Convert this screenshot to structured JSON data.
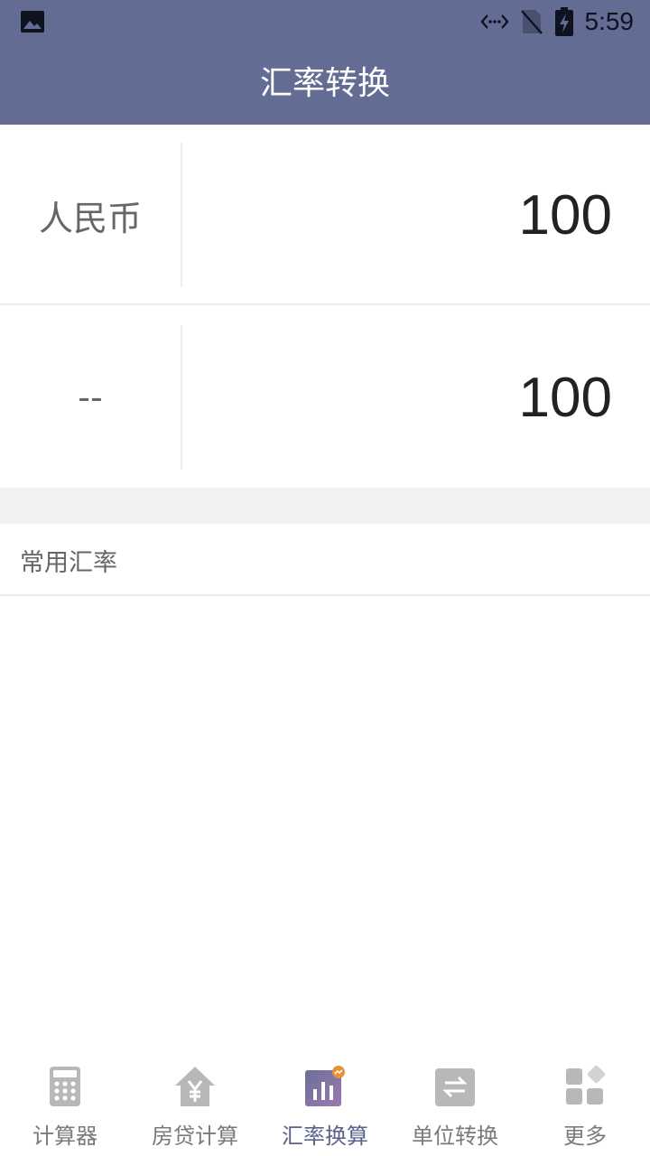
{
  "status_bar": {
    "time": "5:59",
    "icons": [
      "image-icon",
      "data-saver-icon",
      "no-sim-icon",
      "battery-charging-icon"
    ]
  },
  "header": {
    "title": "汇率转换"
  },
  "converter": {
    "from": {
      "currency": "人民币",
      "value": "100"
    },
    "to": {
      "currency": "--",
      "value": "100"
    }
  },
  "section": {
    "title": "常用汇率"
  },
  "tabs": [
    {
      "label": "计算器",
      "icon": "calculator-icon",
      "active": false
    },
    {
      "label": "房贷计算",
      "icon": "house-yuan-icon",
      "active": false
    },
    {
      "label": "汇率换算",
      "icon": "chart-icon",
      "active": true
    },
    {
      "label": "单位转换",
      "icon": "swap-icon",
      "active": false
    },
    {
      "label": "更多",
      "icon": "grid-icon",
      "active": false
    }
  ],
  "colors": {
    "appbar": "#636c93",
    "active_tab": "#5a628a",
    "inactive_tab": "#7a7a7a",
    "accent_badge": "#e8913a"
  }
}
